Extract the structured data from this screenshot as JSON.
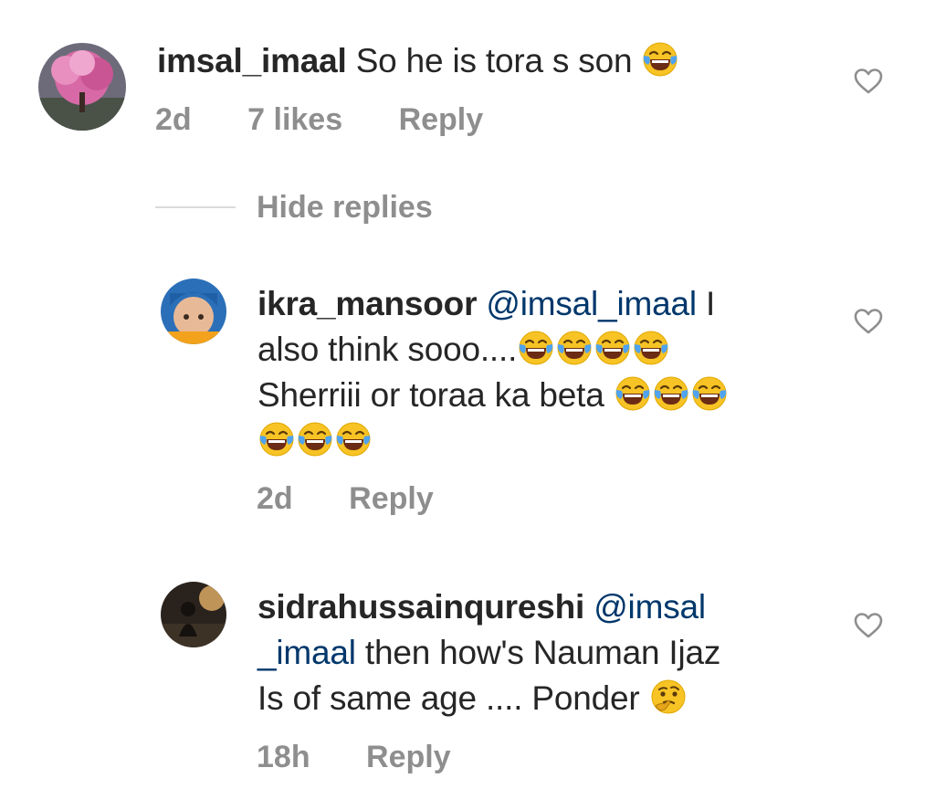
{
  "comments": [
    {
      "username": "imsal_imaal",
      "text_before": "So he is tora s son",
      "time": "2d",
      "likes": "7 likes",
      "reply_label": "Reply"
    },
    {
      "username": "ikra_mansoor",
      "mention": "@imsal_imaal",
      "line1_tail": "I",
      "line2": "also think sooo....",
      "line3": "Sherriii or toraa ka beta",
      "time": "2d",
      "reply_label": "Reply"
    },
    {
      "username": "sidrahussainqureshi",
      "mention_part1": "@imsal",
      "mention_part2": "_imaal",
      "line2_tail": "then how's Nauman Ijaz",
      "line3": "Is of same age .... Ponder",
      "time": "18h",
      "reply_label": "Reply"
    }
  ],
  "hide_replies_label": "Hide replies",
  "icons": {
    "heart": "heart-outline-icon",
    "laugh": "face-with-tears-of-joy-emoji",
    "think": "thinking-face-emoji"
  },
  "colors": {
    "text": "#262626",
    "meta": "#8e8e8e",
    "mention": "#00376b",
    "divider": "#dbdbdb"
  }
}
